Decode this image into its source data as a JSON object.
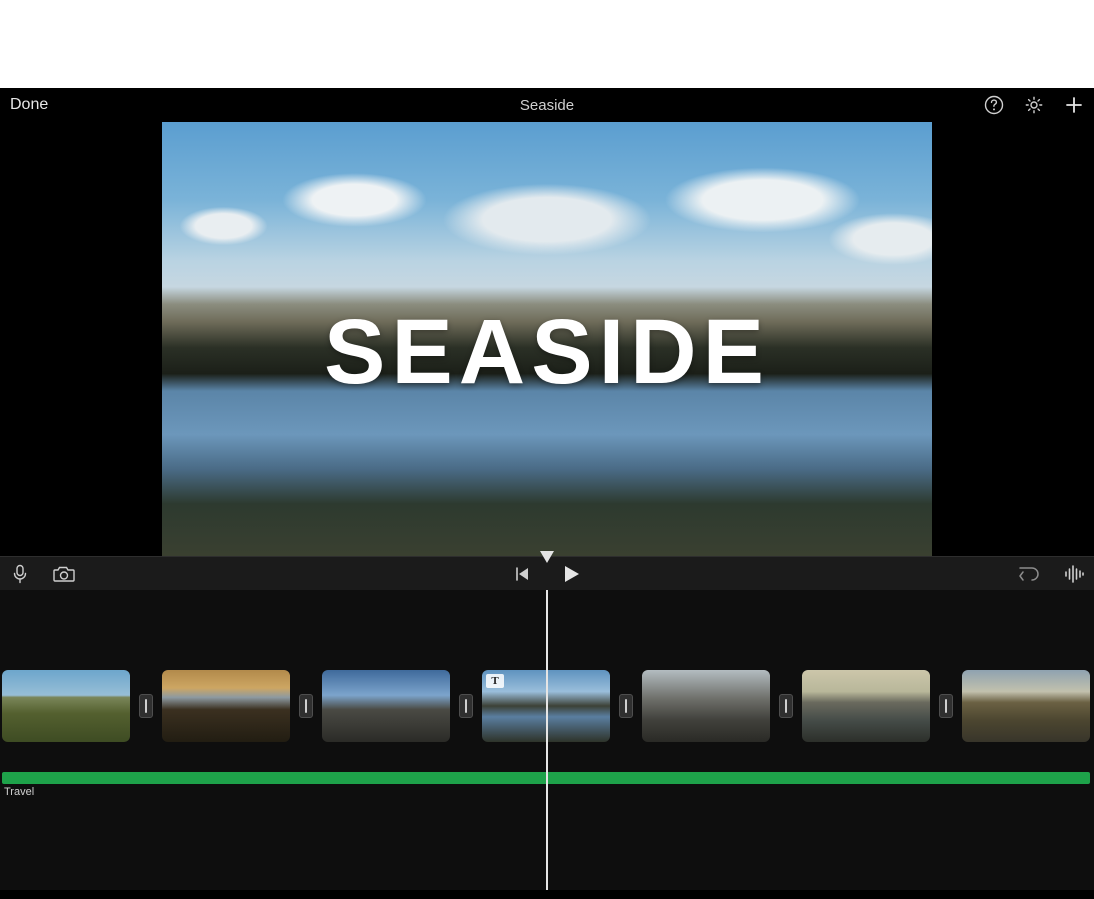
{
  "header": {
    "done_label": "Done",
    "title": "Seaside"
  },
  "preview": {
    "title_overlay": "SEASIDE"
  },
  "timeline": {
    "audio_track_label": "Travel",
    "clips": [
      {
        "id": "clip-1",
        "thumb": "thumb-grass",
        "has_title": false
      },
      {
        "id": "clip-2",
        "thumb": "thumb-sunset",
        "has_title": false
      },
      {
        "id": "clip-3",
        "thumb": "thumb-rocks",
        "has_title": false
      },
      {
        "id": "clip-4",
        "thumb": "thumb-seaside",
        "has_title": true
      },
      {
        "id": "clip-5",
        "thumb": "thumb-waves",
        "has_title": false
      },
      {
        "id": "clip-6",
        "thumb": "thumb-flat",
        "has_title": false
      },
      {
        "id": "clip-7",
        "thumb": "thumb-cliff",
        "has_title": false
      }
    ]
  }
}
